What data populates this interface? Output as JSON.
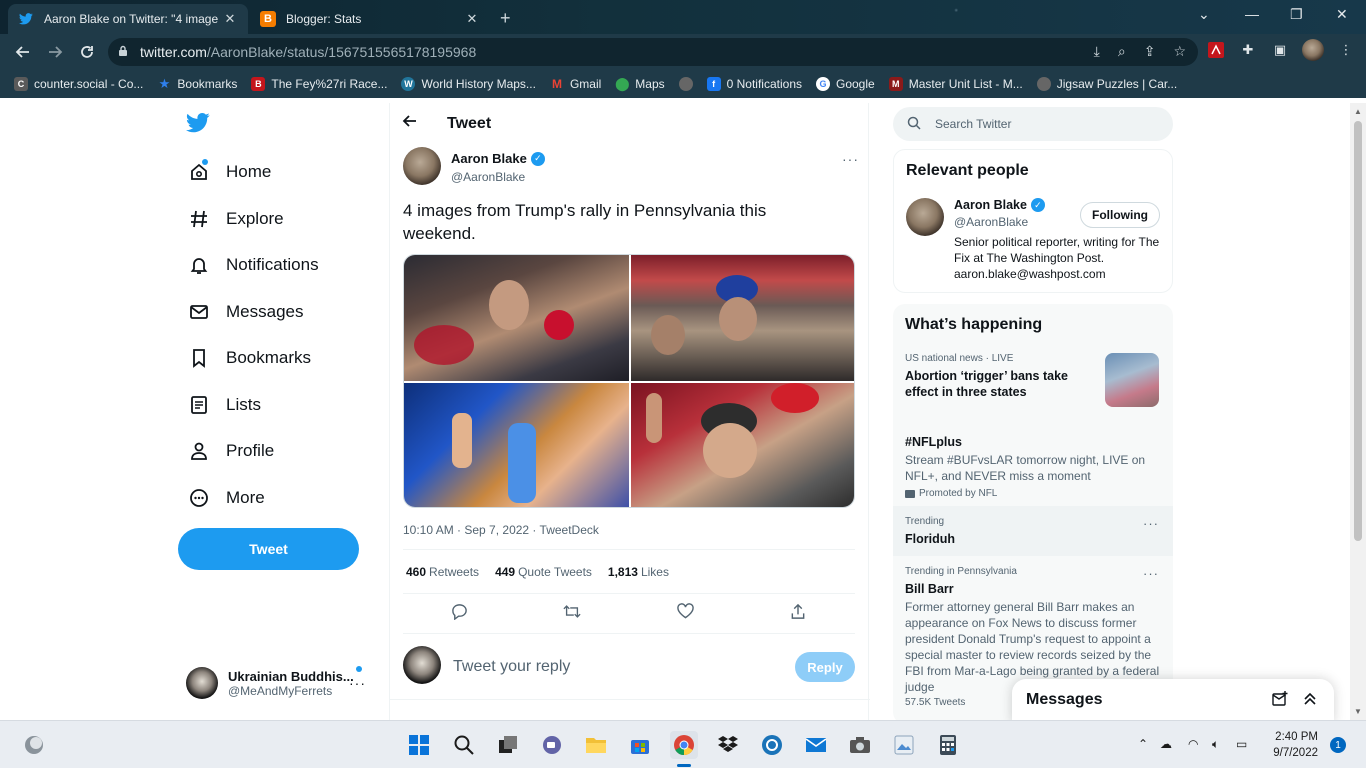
{
  "browser": {
    "tabs": [
      {
        "title": "Aaron Blake on Twitter: \"4 image",
        "close": "✕"
      },
      {
        "title": "Blogger: Stats",
        "close": "✕"
      }
    ],
    "new_tab": "+",
    "window_controls": {
      "minimize": "⌄",
      "restore": "—",
      "maximize": "❐",
      "close": "✕"
    },
    "url_host": "twitter.com",
    "url_path": "/AaronBlake/status/1567515565178195968",
    "bookmarks": [
      {
        "label": "counter.social - Co...",
        "icon": "counter-social-icon",
        "color": "#5a5a5a"
      },
      {
        "label": "Bookmarks",
        "icon": "star-icon",
        "color": "#2f80ed"
      },
      {
        "label": "The Fey%27ri Race...",
        "icon": "b-logo-icon",
        "color": "#c4161c"
      },
      {
        "label": "World History Maps...",
        "icon": "wordpress-icon",
        "color": "#21759b"
      },
      {
        "label": "Gmail",
        "icon": "gmail-icon",
        "color": "#ea4335"
      },
      {
        "label": "Maps",
        "icon": "maps-pin-icon",
        "color": "#34a853"
      },
      {
        "label": "",
        "icon": "globe-icon",
        "color": "#777"
      },
      {
        "label": "0 Notifications",
        "icon": "facebook-icon",
        "color": "#1877f2"
      },
      {
        "label": "Google",
        "icon": "google-icon",
        "color": "#4285f4"
      },
      {
        "label": "Master Unit List - M...",
        "icon": "mul-icon",
        "color": "#8b1a1a"
      },
      {
        "label": "Jigsaw Puzzles | Car...",
        "icon": "puzzle-icon",
        "color": "#666"
      }
    ]
  },
  "sidebar": {
    "items": [
      {
        "label": "Home",
        "icon": "home-icon"
      },
      {
        "label": "Explore",
        "icon": "hashtag-icon"
      },
      {
        "label": "Notifications",
        "icon": "bell-icon"
      },
      {
        "label": "Messages",
        "icon": "envelope-icon"
      },
      {
        "label": "Bookmarks",
        "icon": "bookmark-icon"
      },
      {
        "label": "Lists",
        "icon": "list-icon"
      },
      {
        "label": "Profile",
        "icon": "person-icon"
      },
      {
        "label": "More",
        "icon": "more-circle-icon"
      }
    ],
    "tweet_button": "Tweet",
    "account": {
      "name": "Ukrainian Buddhis...",
      "handle": "@MeAndMyFerrets",
      "more": "···"
    }
  },
  "tweet": {
    "header_title": "Tweet",
    "author_name": "Aaron Blake",
    "author_handle": "@AaronBlake",
    "more": "···",
    "text": "4 images from Trump's rally in Pennsylvania this weekend.",
    "images": [
      "rally photo 1",
      "rally photo 2",
      "rally photo 3",
      "rally photo 4"
    ],
    "meta": "10:10 AM · Sep 7, 2022 · TweetDeck",
    "stats": {
      "retweets_count": "460",
      "retweets_label": "Retweets",
      "quotes_count": "449",
      "quotes_label": "Quote Tweets",
      "likes_count": "1,813",
      "likes_label": "Likes"
    },
    "reply_placeholder": "Tweet your reply",
    "reply_button": "Reply"
  },
  "right": {
    "search_placeholder": "Search Twitter",
    "relevant": {
      "title": "Relevant people",
      "name": "Aaron Blake",
      "handle": "@AaronBlake",
      "follow_label": "Following",
      "bio": "Senior political reporter, writing for The Fix at The Washington Post. aaron.blake@washpost.com"
    },
    "happening": {
      "title": "What’s happening",
      "trends": [
        {
          "context": "US national news · LIVE",
          "title": "Abortion ‘trigger’ bans take effect in three states"
        },
        {
          "title": "#NFLplus",
          "desc": "Stream #BUFvsLAR tomorrow night, LIVE on NFL+, and NEVER miss a moment",
          "promo": "Promoted by NFL"
        },
        {
          "context": "Trending",
          "title": "Floriduh"
        },
        {
          "context": "Trending in Pennsylvania",
          "title": "Bill Barr",
          "desc": "Former attorney general Bill Barr makes an appearance on Fox News to discuss former president Donald Trump's request to appoint a special master to review records seized by the FBI from Mar-a-Lago being granted by a federal judge",
          "count": "57.5K Tweets"
        }
      ]
    },
    "messages_dock": "Messages"
  },
  "taskbar": {
    "time": "2:40 PM",
    "date": "9/7/2022",
    "notification_count": "1"
  }
}
